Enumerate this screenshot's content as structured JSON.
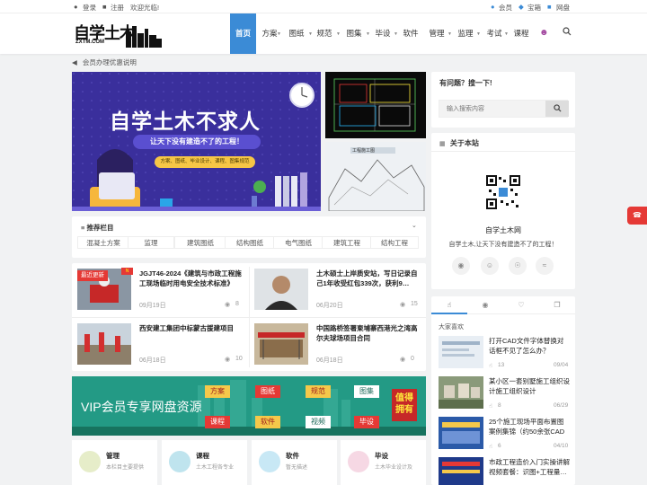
{
  "topbar": {
    "login": "登录",
    "register": "注册",
    "welcome": "欢迎光临!",
    "member": "会员",
    "treasure": "宝箱",
    "netdisk": "网盘"
  },
  "logo": {
    "text_main": "自学土木",
    "text_sub": "ZXTM.COM"
  },
  "nav": [
    {
      "label": "首页"
    },
    {
      "label": "方案"
    },
    {
      "label": "图纸"
    },
    {
      "label": "规范"
    },
    {
      "label": "图集"
    },
    {
      "label": "毕设"
    },
    {
      "label": "软件"
    },
    {
      "label": "管理"
    },
    {
      "label": "监理"
    },
    {
      "label": "考试"
    },
    {
      "label": "课程"
    }
  ],
  "notice": "会员办理优惠说明",
  "banner": {
    "headline": "自学土木不求人",
    "slogan": "让天下没有建造不了的工程！",
    "small": "方案、图纸、毕业设计、课程、图集规范"
  },
  "side_thumb2": {
    "label": "工程施工图"
  },
  "recommend": {
    "title": "推荐栏目",
    "tags": [
      "混凝土方案",
      "监理",
      "建筑图纸",
      "结构图纸",
      "电气图纸",
      "建筑工程",
      "结构工程"
    ]
  },
  "posts": [
    {
      "badge": "最近更新",
      "title": "JGJT46-2024《建筑与市政工程施工现场临时用电安全技术标准》",
      "date": "09月19日",
      "count": "8"
    },
    {
      "title": "土木硕士上岸质安站，写日记录自己1年收受红包339次，获利9…",
      "date": "06月20日",
      "count": "15"
    },
    {
      "title": "西安建工集团中标蒙古援建项目",
      "date": "06月18日",
      "count": "10"
    },
    {
      "title": "中国路桥签署柬埔寨西港光之湾高尔夫球场项目合同",
      "date": "06月18日",
      "count": "0"
    }
  ],
  "vip": {
    "title": "VIP会员专享网盘资源",
    "chips": [
      "方案",
      "图纸",
      "规范",
      "图集",
      "课程",
      "软件",
      "视频",
      "毕设"
    ],
    "cta": "值得拥有"
  },
  "features": [
    {
      "title": "管理",
      "desc": "本栏目主要提供"
    },
    {
      "title": "课程",
      "desc": "土木工程各专业"
    },
    {
      "title": "软件",
      "desc": "暂无描述"
    },
    {
      "title": "毕设",
      "desc": "土木毕业设计及"
    }
  ],
  "search": {
    "title": "有问题？搜一下!",
    "placeholder": "输入搜索内容"
  },
  "about": {
    "title": "关于本站",
    "name": "自学土木网",
    "desc": "自学土木,让天下没有建造不了的工程！"
  },
  "sidebar_list": {
    "heading": "大家喜欢",
    "items": [
      {
        "title": "打开CAD文件字体替换对话框不见了怎么办？",
        "count": "13",
        "date": "09/04"
      },
      {
        "title": "某小区一套别墅施工组织设计施工组织设计",
        "count": "8",
        "date": "06/29"
      },
      {
        "title": "25个施工现场平面布置图案例集锦（约50余张CAD图…",
        "count": "6",
        "date": "04/10"
      },
      {
        "title": "市政工程造价入门实操讲解视频套餐：识图+工程量…",
        "count": "",
        "date": ""
      }
    ]
  },
  "colors": {
    "accent": "#3b8bd6",
    "banner_bg": "#3a2f9c",
    "badge": "#e53935",
    "vip_bg": "#1e8a7a"
  }
}
